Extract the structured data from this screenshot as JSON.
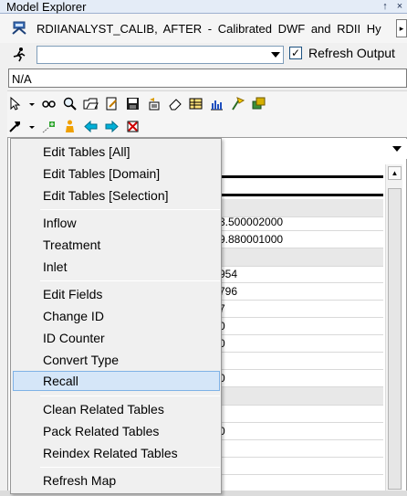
{
  "window": {
    "title": "Model Explorer",
    "pin_glyph": "↑",
    "close_glyph": "×"
  },
  "scenario": {
    "text": "RDIIANALYST_CALIB, AFTER - Calibrated DWF and RDII Hy",
    "icon": "scenario-icon"
  },
  "output_row": {
    "select_value": "",
    "refresh_output_checked": true,
    "refresh_output_label": "Refresh Output",
    "check_glyph": "✓"
  },
  "layer_select": {
    "value": "N/A"
  },
  "grid": {
    "values": [
      "3.500002000",
      "9.880001000",
      "954",
      "796",
      "7",
      "0",
      "0",
      "0",
      "0"
    ]
  },
  "context_menu": {
    "items": [
      "Edit Tables [All]",
      "Edit Tables [Domain]",
      "Edit Tables [Selection]",
      "Inflow",
      "Treatment",
      "Inlet",
      "Edit Fields",
      "Change ID",
      "ID Counter",
      "Convert Type",
      "Recall",
      "Clean Related Tables",
      "Pack Related Tables",
      "Reindex Related Tables",
      "Refresh Map"
    ],
    "highlighted": "Recall"
  },
  "colors": {
    "highlight_bg": "#d5e6f8",
    "highlight_border": "#7fb2e6",
    "titlebar_bg": "#e4ecf7"
  }
}
